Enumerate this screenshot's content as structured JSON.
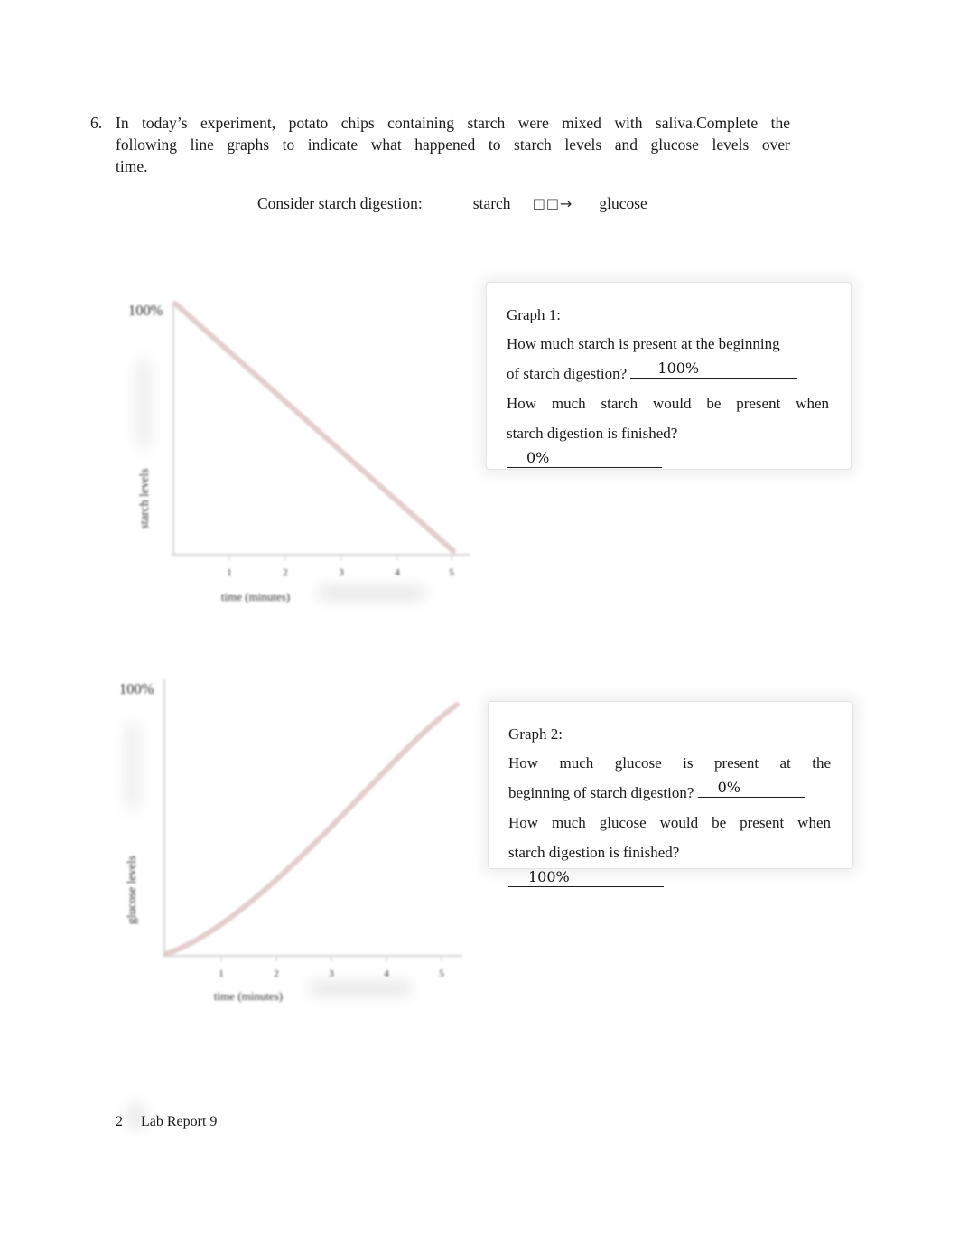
{
  "question": {
    "number": "6.",
    "text_segment_1": "In today’s experiment, potato chips containing starch were mixed with saliva.",
    "text_segment_2": "Complete the",
    "text_segment_3": "following line graphs to indicate what happened to starch levels and glucose levels over",
    "text_segment_4": "time."
  },
  "equation": {
    "prompt": "Consider starch digestion:",
    "reactant": "starch",
    "missing_glyphs": "□□",
    "arrow": "→",
    "product": "glucose"
  },
  "chart_data": [
    {
      "type": "line",
      "id": "graph-1",
      "title": "",
      "xlabel": "time (minutes)",
      "ylabel": "starch levels",
      "y_max_label": "100%",
      "x_tick_labels": [
        "1",
        "2",
        "3",
        "4",
        "5"
      ],
      "x": [
        0,
        5
      ],
      "values": [
        100,
        0
      ],
      "ylim": [
        0,
        100
      ],
      "xlim": [
        0,
        5
      ],
      "grid": false,
      "legend": "none",
      "line_color": "#e2c9c9"
    },
    {
      "type": "line",
      "id": "graph-2",
      "title": "",
      "xlabel": "time (minutes)",
      "ylabel": "glucose levels",
      "y_max_label": "100%",
      "x_tick_labels": [
        "1",
        "2",
        "3",
        "4",
        "5"
      ],
      "x": [
        0,
        1,
        2,
        3,
        4,
        5
      ],
      "values": [
        0,
        14,
        33,
        54,
        76,
        100
      ],
      "ylim": [
        0,
        100
      ],
      "xlim": [
        0,
        5
      ],
      "grid": false,
      "legend": "none",
      "line_color": "#e2c9c9"
    }
  ],
  "callouts": [
    {
      "title": "Graph 1:",
      "q1_part1": "How much starch is present at the beginning",
      "q1_part2": "of starch digestion?",
      "q1_answer": "100%",
      "q2_part1": "How much starch would be present when",
      "q2_part2": "starch digestion is finished?",
      "q2_answer": "0%"
    },
    {
      "title": "Graph 2:",
      "q1_part1": "How much glucose is present at the",
      "q1_part2": "beginning of starch digestion?",
      "q1_answer": "0%",
      "q2_part1": "How much glucose would be present when",
      "q2_part2": "starch digestion is finished?",
      "q2_answer": "100%"
    }
  ],
  "footer": {
    "page_number": "2",
    "document_title": "Lab Report 9"
  }
}
